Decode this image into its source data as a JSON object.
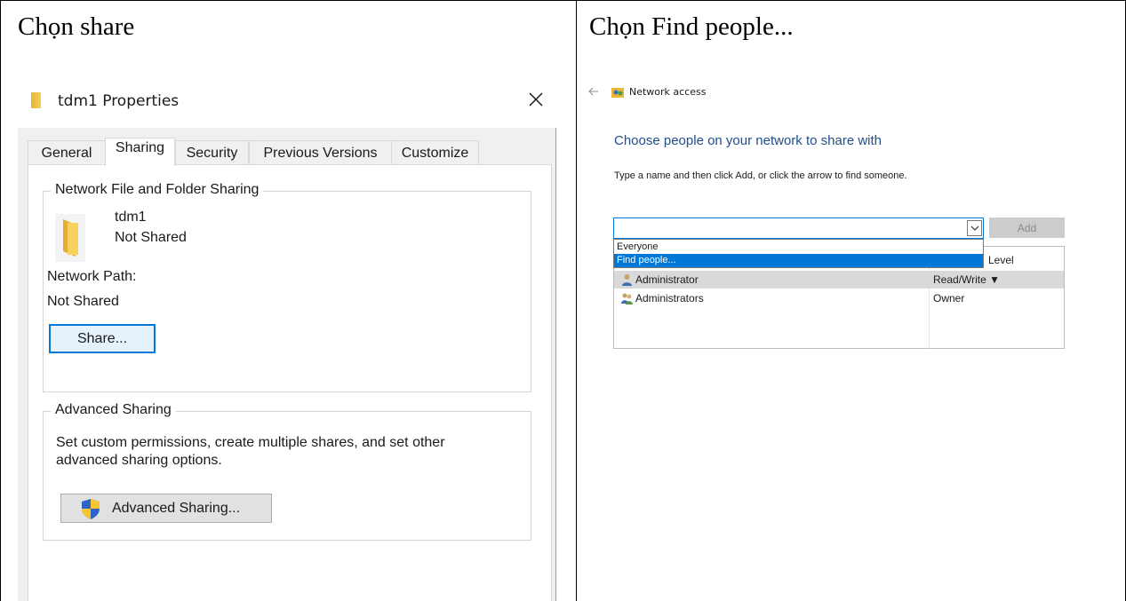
{
  "captions": {
    "left": "Chọn share",
    "right": "Chọn Find people..."
  },
  "properties_dialog": {
    "title": "tdm1 Properties",
    "tabs": [
      {
        "label": "General",
        "active": false
      },
      {
        "label": "Sharing",
        "active": true
      },
      {
        "label": "Security",
        "active": false
      },
      {
        "label": "Previous Versions",
        "active": false
      },
      {
        "label": "Customize",
        "active": false
      }
    ],
    "network_sharing": {
      "legend": "Network File and Folder Sharing",
      "folder_name": "tdm1",
      "status": "Not Shared",
      "network_path_label": "Network Path:",
      "network_path_value": "Not Shared",
      "share_button": "Share..."
    },
    "advanced_sharing": {
      "legend": "Advanced Sharing",
      "description_line1": "Set custom permissions, create multiple shares, and set other",
      "description_line2": "advanced sharing options.",
      "button": "Advanced Sharing..."
    }
  },
  "network_access": {
    "window_title": "Network access",
    "heading": "Choose people on your network to share with",
    "instruction": "Type a name and then click Add, or click the arrow to find someone.",
    "input_value": "",
    "add_button": "Add",
    "dropdown_options": [
      "Everyone",
      "Find people..."
    ],
    "highlighted_option": "Find people...",
    "column_level": "Level",
    "rows": [
      {
        "name": "Administrator",
        "permission": "Read/Write ▼",
        "selected": true
      },
      {
        "name": "Administrators",
        "permission": "Owner",
        "selected": false
      }
    ]
  },
  "colors": {
    "accent": "#0078d7",
    "heading_blue": "#1e4e8c",
    "folder_yellow": "#f6cf59"
  }
}
